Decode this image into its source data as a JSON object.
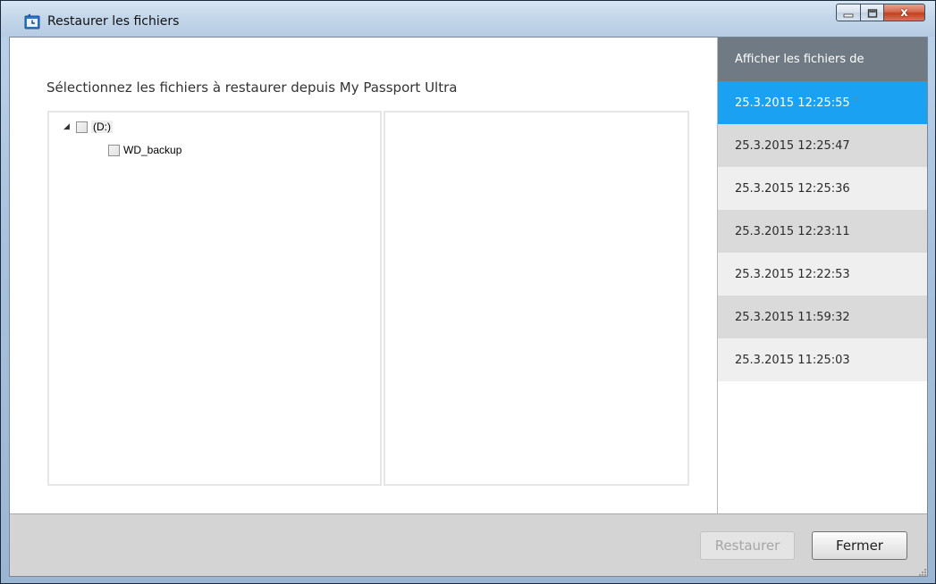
{
  "window": {
    "title": "Restaurer les fichiers",
    "close_glyph": "x"
  },
  "main": {
    "instruction": "Sélectionnez les fichiers à restaurer depuis My Passport Ultra",
    "tree": [
      {
        "label": "(D:)",
        "expander": "◢",
        "checked": false
      },
      {
        "label": "WD_backup",
        "checked": false
      }
    ]
  },
  "sidebar": {
    "header": "Afficher les fichiers de",
    "snapshots": [
      {
        "label": "25.3.2015 12:25:55",
        "selected": true
      },
      {
        "label": "25.3.2015 12:25:47",
        "selected": false
      },
      {
        "label": "25.3.2015 12:25:36",
        "selected": false
      },
      {
        "label": "25.3.2015 12:23:11",
        "selected": false
      },
      {
        "label": "25.3.2015 12:22:53",
        "selected": false
      },
      {
        "label": "25.3.2015 11:59:32",
        "selected": false
      },
      {
        "label": "25.3.2015 11:25:03",
        "selected": false
      }
    ]
  },
  "footer": {
    "restore_label": "Restaurer",
    "restore_enabled": false,
    "close_label": "Fermer"
  },
  "colors": {
    "selected_snapshot": "#1ba1f2",
    "sidebar_header": "#6f7a84"
  },
  "icons": {
    "app": "restore-clock-icon",
    "minimize": "minimize-icon",
    "maximize": "maximize-icon",
    "close": "close-icon",
    "expander": "expander-triangle-icon",
    "resize": "resize-grip-icon"
  }
}
